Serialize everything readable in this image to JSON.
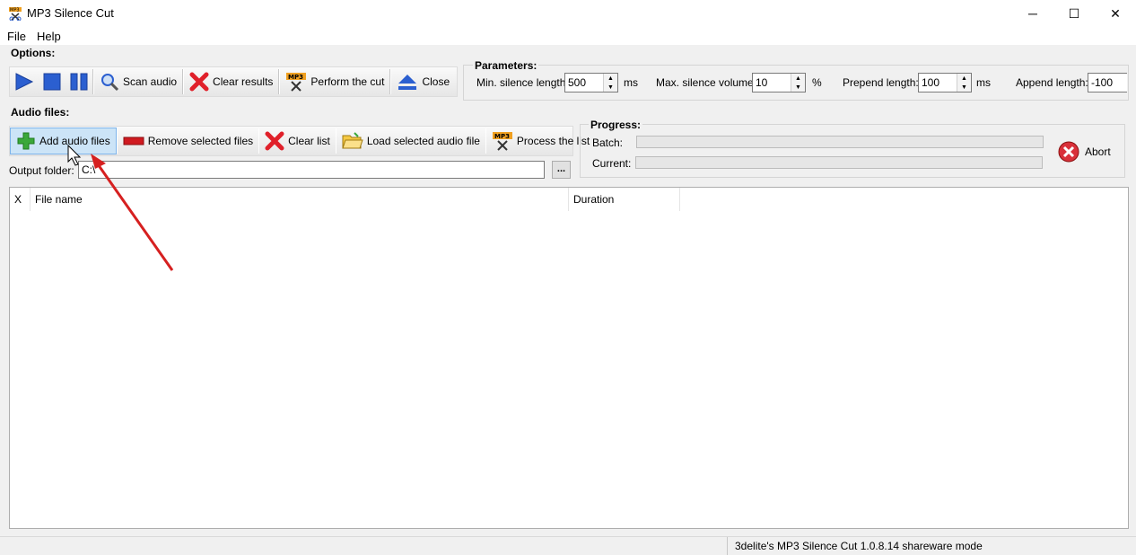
{
  "window": {
    "title": "MP3 Silence Cut",
    "minimize": "─",
    "maximize": "☐",
    "close": "✕"
  },
  "menu": {
    "file": "File",
    "help": "Help"
  },
  "options": {
    "label": "Options:",
    "scan": "Scan audio",
    "clear_results": "Clear results",
    "perform_cut": "Perform the cut",
    "close": "Close"
  },
  "parameters": {
    "label": "Parameters:",
    "min_silence_label": "Min. silence length:",
    "min_silence_value": "500",
    "min_silence_unit": "ms",
    "max_volume_label": "Max. silence volume:",
    "max_volume_value": "10",
    "max_volume_unit": "%",
    "prepend_label": "Prepend length:",
    "prepend_value": "100",
    "prepend_unit": "ms",
    "append_label": "Append length:",
    "append_value": "-100"
  },
  "audio_files": {
    "label": "Audio files:",
    "add": "Add audio files",
    "remove": "Remove selected files",
    "clear_list": "Clear list",
    "load_selected": "Load selected audio file",
    "process_list": "Process the list",
    "output_label": "Output folder:",
    "output_value": "C:\\",
    "browse": "..."
  },
  "progress": {
    "label": "Progress:",
    "batch_label": "Batch:",
    "batch_fraction": 0,
    "current_label": "Current:",
    "current_fraction": 0,
    "abort": "Abort"
  },
  "table": {
    "columns": [
      "X",
      "File name",
      "Duration"
    ],
    "rows": []
  },
  "status": {
    "text": "3delite's MP3 Silence Cut 1.0.8.14 shareware mode"
  },
  "colors": {
    "play_blue": "#2b5fd0",
    "clear_red": "#e0202a",
    "add_green": "#3aa83a",
    "annotation_arrow": "#d62020"
  }
}
